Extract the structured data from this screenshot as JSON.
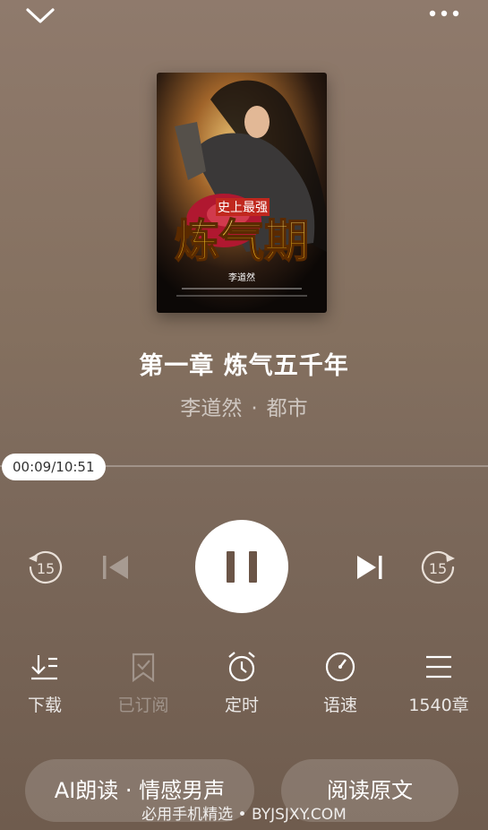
{
  "header": {
    "collapse_icon": "chevron-down-icon",
    "more_icon": "more-dots-icon"
  },
  "cover": {
    "banner_text": "史上最强",
    "title_text": "炼气期",
    "author_text": "李道然",
    "colors": {
      "title": "#f0c020",
      "banner": "#c0281e",
      "armor": "#b01830"
    }
  },
  "chapter": {
    "title": "第一章 炼气五千年"
  },
  "book": {
    "author": "李道然",
    "separator": "·",
    "genre": "都市"
  },
  "player": {
    "time": "00:09/10:51",
    "progress": 0.0138,
    "rewind_seconds": "15",
    "forward_seconds": "15",
    "state": "playing"
  },
  "actions": [
    {
      "label": "下载",
      "icon": "download-icon",
      "enabled": true
    },
    {
      "label": "已订阅",
      "icon": "bookmark-icon",
      "enabled": false
    },
    {
      "label": "定时",
      "icon": "alarm-clock-icon",
      "enabled": true
    },
    {
      "label": "语速",
      "icon": "speed-gauge-icon",
      "enabled": true
    },
    {
      "label": "1540章",
      "icon": "menu-list-icon",
      "enabled": true
    }
  ],
  "buttons": {
    "ai_voice": "AI朗读 · 情感男声",
    "read_original": "阅读原文"
  },
  "watermark": "必用手机精选 • BYJSJXY.COM"
}
